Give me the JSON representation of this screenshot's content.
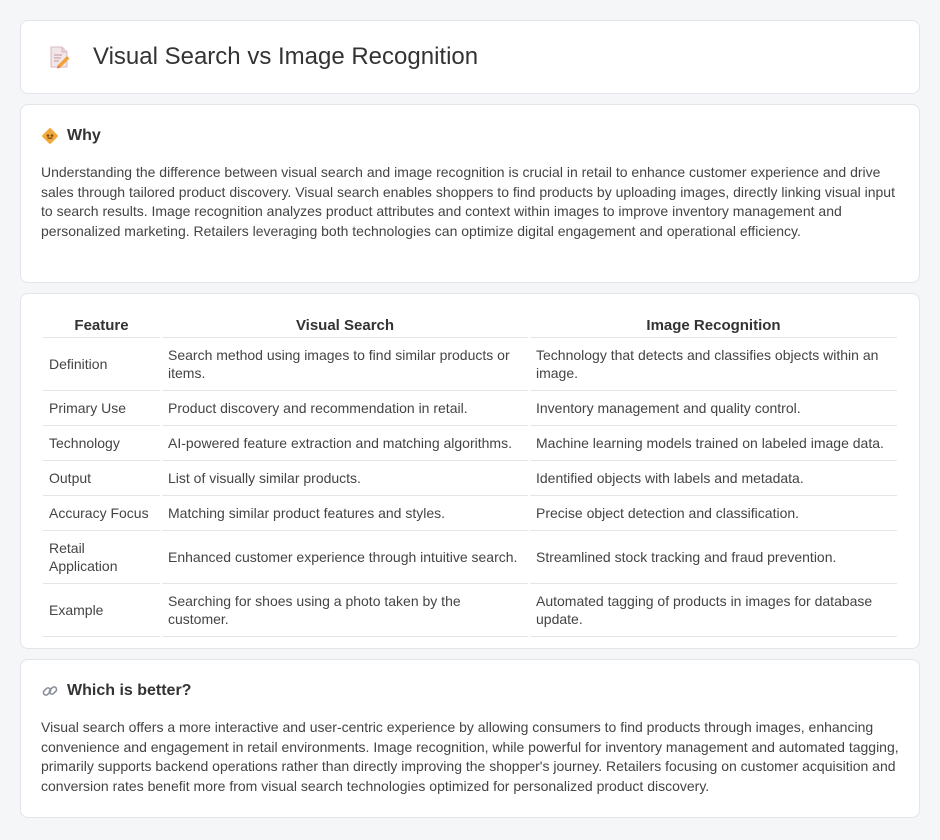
{
  "header": {
    "title": "Visual Search vs Image Recognition",
    "icon": "document-pencil-icon"
  },
  "why": {
    "icon": "diamond-sign-icon",
    "title": "Why",
    "text": "Understanding the difference between visual search and image recognition is crucial in retail to enhance customer experience and drive sales through tailored product discovery. Visual search enables shoppers to find products by uploading images, directly linking visual input to search results. Image recognition analyzes product attributes and context within images to improve inventory management and personalized marketing. Retailers leveraging both technologies can optimize digital engagement and operational efficiency."
  },
  "table": {
    "headers": [
      "Feature",
      "Visual Search",
      "Image Recognition"
    ],
    "rows": [
      [
        "Definition",
        "Search method using images to find similar products or items.",
        "Technology that detects and classifies objects within an image."
      ],
      [
        "Primary Use",
        "Product discovery and recommendation in retail.",
        "Inventory management and quality control."
      ],
      [
        "Technology",
        "AI-powered feature extraction and matching algorithms.",
        "Machine learning models trained on labeled image data."
      ],
      [
        "Output",
        "List of visually similar products.",
        "Identified objects with labels and metadata."
      ],
      [
        "Accuracy Focus",
        "Matching similar product features and styles.",
        "Precise object detection and classification."
      ],
      [
        "Retail Application",
        "Enhanced customer experience through intuitive search.",
        "Streamlined stock tracking and fraud prevention."
      ],
      [
        "Example",
        "Searching for shoes using a photo taken by the customer.",
        "Automated tagging of products in images for database update."
      ]
    ]
  },
  "better": {
    "icon": "link-icon",
    "title": "Which is better?",
    "text": "Visual search offers a more interactive and user-centric experience by allowing consumers to find products through images, enhancing convenience and engagement in retail environments. Image recognition, while powerful for inventory management and automated tagging, primarily supports backend operations rather than directly improving the shopper's journey. Retailers focusing on customer acquisition and conversion rates benefit more from visual search technologies optimized for personalized product discovery."
  }
}
